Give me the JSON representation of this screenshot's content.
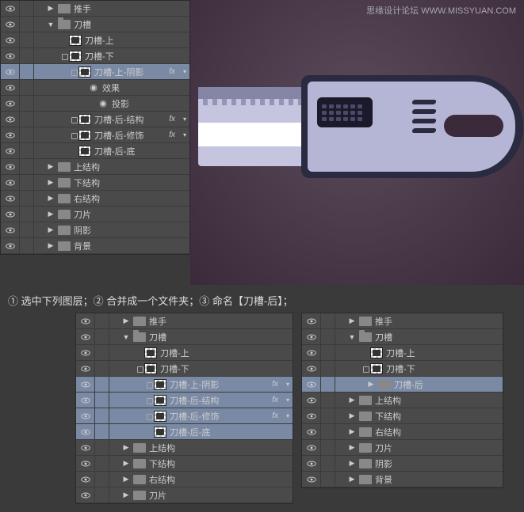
{
  "watermark": {
    "title": "思缘设计论坛",
    "url": "WWW.MISSYUAN.COM"
  },
  "instruction": "① 选中下列图层；② 合并成一个文件夹；③ 命名【刀槽-后】；",
  "panelA": {
    "rows": [
      {
        "t": "folder",
        "label": "推手",
        "arrow": "▶",
        "ind": 1,
        "vis": true
      },
      {
        "t": "folder",
        "label": "刀槽",
        "arrow": "▼",
        "ind": 1,
        "vis": true,
        "open": true
      },
      {
        "t": "layer",
        "label": "刀槽-上",
        "ind": 3,
        "vis": true
      },
      {
        "t": "layer",
        "label": "刀槽-下",
        "ind": 3,
        "vis": true,
        "link": true
      },
      {
        "t": "layer",
        "label": "刀槽-上-阴影",
        "ind": 4,
        "vis": true,
        "sel": true,
        "fx": true,
        "link": true
      },
      {
        "t": "fx",
        "label": "效果",
        "ind": 5,
        "vis": true
      },
      {
        "t": "fx",
        "label": "投影",
        "ind": 6,
        "vis": true
      },
      {
        "t": "layer",
        "label": "刀槽-后-结构",
        "ind": 4,
        "vis": true,
        "fx": true,
        "link": true
      },
      {
        "t": "layer",
        "label": "刀槽-后-修饰",
        "ind": 4,
        "vis": true,
        "fx": true,
        "link": true
      },
      {
        "t": "layer",
        "label": "刀槽-后-底",
        "ind": 4,
        "vis": true
      },
      {
        "t": "folder",
        "label": "上结构",
        "arrow": "▶",
        "ind": 1,
        "vis": true
      },
      {
        "t": "folder",
        "label": "下结构",
        "arrow": "▶",
        "ind": 1,
        "vis": true
      },
      {
        "t": "folder",
        "label": "右结构",
        "arrow": "▶",
        "ind": 1,
        "vis": true
      },
      {
        "t": "folder",
        "label": "刀片",
        "arrow": "▶",
        "ind": 1,
        "vis": true
      },
      {
        "t": "folder",
        "label": "阴影",
        "arrow": "▶",
        "ind": 1,
        "vis": true
      },
      {
        "t": "folder",
        "label": "背景",
        "arrow": "▶",
        "ind": 1,
        "vis": true
      }
    ]
  },
  "panelB": {
    "rows": [
      {
        "t": "folder",
        "label": "推手",
        "arrow": "▶",
        "ind": 1,
        "vis": true
      },
      {
        "t": "folder",
        "label": "刀槽",
        "arrow": "▼",
        "ind": 1,
        "vis": true,
        "open": true
      },
      {
        "t": "layer",
        "label": "刀槽-上",
        "ind": 3,
        "vis": true
      },
      {
        "t": "layer",
        "label": "刀槽-下",
        "ind": 3,
        "vis": true,
        "link": true
      },
      {
        "t": "layer",
        "label": "刀槽-上-阴影",
        "ind": 4,
        "vis": true,
        "sel": true,
        "fx": true,
        "link": true
      },
      {
        "t": "layer",
        "label": "刀槽-后-结构",
        "ind": 4,
        "vis": true,
        "sel": true,
        "fx": true,
        "link": true
      },
      {
        "t": "layer",
        "label": "刀槽-后-修饰",
        "ind": 4,
        "vis": true,
        "sel": true,
        "fx": true,
        "link": true
      },
      {
        "t": "layer",
        "label": "刀槽-后-底",
        "ind": 4,
        "vis": true,
        "sel": true
      },
      {
        "t": "folder",
        "label": "上结构",
        "arrow": "▶",
        "ind": 1,
        "vis": true
      },
      {
        "t": "folder",
        "label": "下结构",
        "arrow": "▶",
        "ind": 1,
        "vis": true
      },
      {
        "t": "folder",
        "label": "右结构",
        "arrow": "▶",
        "ind": 1,
        "vis": true
      },
      {
        "t": "folder",
        "label": "刀片",
        "arrow": "▶",
        "ind": 1,
        "vis": true
      }
    ]
  },
  "panelC": {
    "rows": [
      {
        "t": "folder",
        "label": "推手",
        "arrow": "▶",
        "ind": 1,
        "vis": true
      },
      {
        "t": "folder",
        "label": "刀槽",
        "arrow": "▼",
        "ind": 1,
        "vis": true,
        "open": true
      },
      {
        "t": "layer",
        "label": "刀槽-上",
        "ind": 3,
        "vis": true
      },
      {
        "t": "layer",
        "label": "刀槽-下",
        "ind": 3,
        "vis": true,
        "link": true
      },
      {
        "t": "folder",
        "label": "刀槽-后",
        "arrow": "▶",
        "ind": 3,
        "vis": true,
        "sel": true
      },
      {
        "t": "folder",
        "label": "上结构",
        "arrow": "▶",
        "ind": 1,
        "vis": true
      },
      {
        "t": "folder",
        "label": "下结构",
        "arrow": "▶",
        "ind": 1,
        "vis": true
      },
      {
        "t": "folder",
        "label": "右结构",
        "arrow": "▶",
        "ind": 1,
        "vis": true
      },
      {
        "t": "folder",
        "label": "刀片",
        "arrow": "▶",
        "ind": 1,
        "vis": true
      },
      {
        "t": "folder",
        "label": "阴影",
        "arrow": "▶",
        "ind": 1,
        "vis": true
      },
      {
        "t": "folder",
        "label": "背景",
        "arrow": "▶",
        "ind": 1,
        "vis": true
      }
    ]
  }
}
